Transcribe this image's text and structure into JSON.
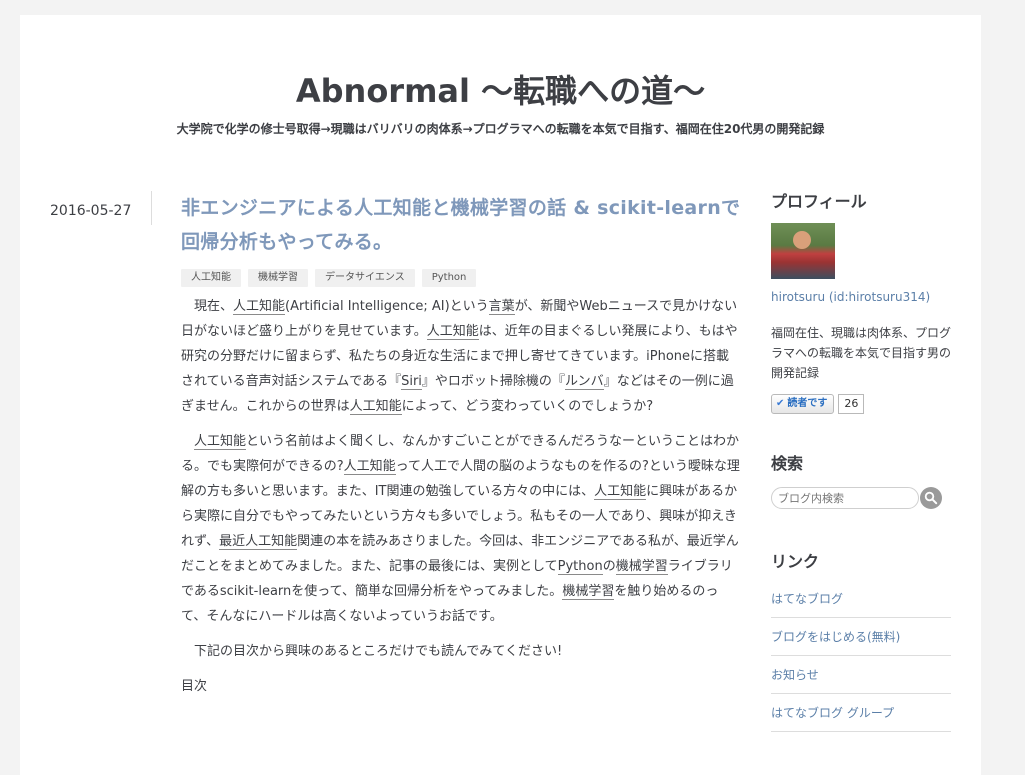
{
  "blog": {
    "title": "Abnormal 〜転職への道〜",
    "description": "大学院で化学の修士号取得→現職はバリバリの肉体系→プログラマへの転職を本気で目指す、福岡在住20代男の開発記録"
  },
  "entry": {
    "date": "2016-05-27",
    "title": "非エンジニアによる人工知能と機械学習の話 & scikit-learnで回帰分析もやってみる。",
    "categories": [
      "人工知能",
      "機械学習",
      "データサイエンス",
      "Python"
    ],
    "paragraphs": [
      [
        {
          "t": "現在、"
        },
        {
          "t": "人工知能",
          "kw": true
        },
        {
          "t": "(Artificial Intelligence; AI)という"
        },
        {
          "t": "言葉",
          "kw": true
        },
        {
          "t": "が、新聞やWebニュースで見かけない日がないほど盛り上がりを見せています。"
        },
        {
          "t": "人工知能",
          "kw": true
        },
        {
          "t": "は、近年の目まぐるしい発展により、もはや研究の分野だけに留まらず、私たちの身近な生活にまで押し寄せてきています。iPhoneに搭載されている音声対話システムである『"
        },
        {
          "t": "Siri",
          "kw": true
        },
        {
          "t": "』やロボット掃除機の『"
        },
        {
          "t": "ルンバ",
          "kw": true
        },
        {
          "t": "』などはその一例に過ぎません。これからの世界は"
        },
        {
          "t": "人工知能",
          "kw": true
        },
        {
          "t": "によって、どう変わっていくのでしょうか?"
        }
      ],
      [
        {
          "t": "人工知能",
          "kw": true
        },
        {
          "t": "という名前はよく聞くし、なんかすごいことができるんだろうなーということはわかる。でも実際何ができるの?"
        },
        {
          "t": "人工知能",
          "kw": true
        },
        {
          "t": "って人工で人間の脳のようなものを作るの?という曖昧な理解の方も多いと思います。また、IT関連の勉強している方々の中には、"
        },
        {
          "t": "人工知能",
          "kw": true
        },
        {
          "t": "に興味があるから実際に自分でもやってみたいという方々も多いでしょう。私もその一人であり、興味が抑えきれず、"
        },
        {
          "t": "最近人工知能",
          "kw": true
        },
        {
          "t": "関連の本を読みあさりました。今回は、非エンジニアである私が、最近学んだことをまとめてみました。また、記事の最後には、実例として"
        },
        {
          "t": "Python",
          "kw": true
        },
        {
          "t": "の"
        },
        {
          "t": "機械学習",
          "kw": true
        },
        {
          "t": "ライブラリであるscikit-learnを使って、簡単な回帰分析をやってみました。"
        },
        {
          "t": "機械学習",
          "kw": true
        },
        {
          "t": "を触り始めるのって、そんなにハードルは高くないよっていうお話です。"
        }
      ],
      [
        {
          "t": "下記の目次から興味のあるところだけでも読んでみてください!"
        }
      ]
    ],
    "toc_label": "目次"
  },
  "sidebar": {
    "profile": {
      "title": "プロフィール",
      "name": "hirotsuru (id:hirotsuru314)",
      "description": "福岡在住、現職は肉体系、プログラマへの転職を本気で目指す男の開発記録",
      "reader_button": "読者です",
      "reader_count": "26"
    },
    "search": {
      "title": "検索",
      "placeholder": "ブログ内検索"
    },
    "links": {
      "title": "リンク",
      "items": [
        "はてなブログ",
        "ブログをはじめる(無料)",
        "お知らせ",
        "はてなブログ グループ"
      ]
    }
  }
}
